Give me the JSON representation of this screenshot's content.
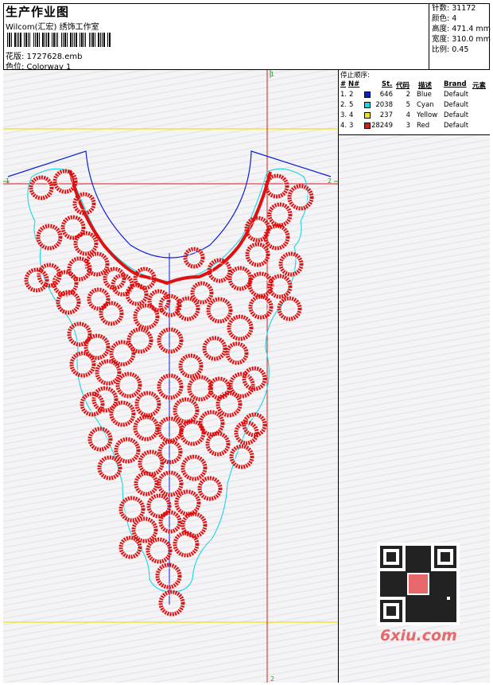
{
  "header": {
    "title": "生产作业图",
    "subtitle": "Wilcom(汇宏) 绣饰工作室",
    "design_file": "花版:  1727628.emb",
    "colorway": "色位:  Colorway 1"
  },
  "stats": [
    "针数: 31172",
    "颜色: 4",
    "高度: 471.4 mm",
    "宽度: 310.0 mm",
    "比例: 0.45"
  ],
  "stop_sequence": {
    "title": "停止顺序:",
    "headers": [
      "#",
      "N#",
      "St.",
      "代码",
      "描述",
      "Brand",
      "元素"
    ],
    "rows": [
      {
        "num": "1.",
        "n": "2",
        "stitches": "646",
        "code": "2",
        "desc": "Blue",
        "brand": "Default",
        "color": "#0a1fd6"
      },
      {
        "num": "2.",
        "n": "5",
        "stitches": "2038",
        "code": "5",
        "desc": "Cyan",
        "brand": "Default",
        "color": "#19d7e0"
      },
      {
        "num": "3.",
        "n": "4",
        "stitches": "237",
        "code": "4",
        "desc": "Yellow",
        "brand": "Default",
        "color": "#f0e21a"
      },
      {
        "num": "4.",
        "n": "3",
        "stitches": "28249",
        "code": "3",
        "desc": "Red",
        "brand": "Default",
        "color": "#d81a1a"
      }
    ]
  },
  "markers": {
    "top": "1",
    "bottom": "2",
    "left": "1",
    "right": "2"
  },
  "watermark": "6xiu.com",
  "colors": {
    "guide_red": "#d81a1a",
    "guide_green": "#2aa02a",
    "guide_yellow": "#f0e21a",
    "outline_cyan": "#19d7e0",
    "outline_blue": "#0a1fd6",
    "embroidery_red": "#e01010"
  }
}
